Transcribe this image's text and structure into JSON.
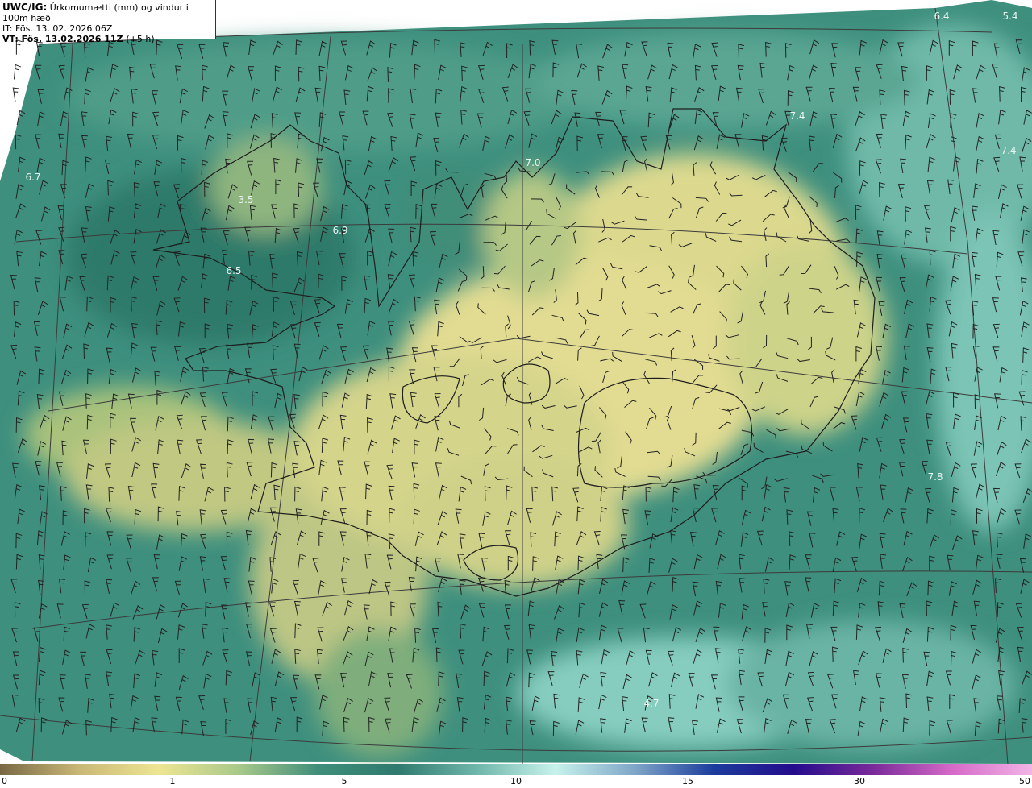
{
  "header": {
    "product_code": "UWC/IG:",
    "product_title": "Úrkomumætti (mm) og vindur i 100m hæð",
    "init_time": "IT: Fös. 13. 02. 2026 06Z",
    "valid_time": "VT: Fös. 13.02.2026 11Z",
    "lead_time": "(+5 h)"
  },
  "map_values": [
    "6.4",
    "5.4",
    "7.4",
    "7.4",
    "6.7",
    "7.0",
    "3.5",
    "6.9",
    "6.5",
    "7.8",
    "4.7"
  ],
  "colorbar": {
    "labels": [
      "0",
      "1",
      "5",
      "10",
      "15",
      "30",
      "50"
    ],
    "colors": [
      "#7a6845",
      "#c9b876",
      "#eee593",
      "#a9c98a",
      "#3f8e7a",
      "#2f7a6e",
      "#6fb6aa",
      "#c7f2ec",
      "#7fa6c8",
      "#1c3c9c",
      "#240c8c",
      "#7a2a9a",
      "#d66ac8",
      "#f2b4e6"
    ]
  },
  "colors": {
    "land_low": "#e6df8e",
    "land_mid": "#a9c47e",
    "sea_deep": "#2f7e6d",
    "sea_mid": "#3f9180",
    "sea_light": "#82c6b8",
    "coast": "#1d1d1d",
    "grid": "#3b3b3b"
  }
}
